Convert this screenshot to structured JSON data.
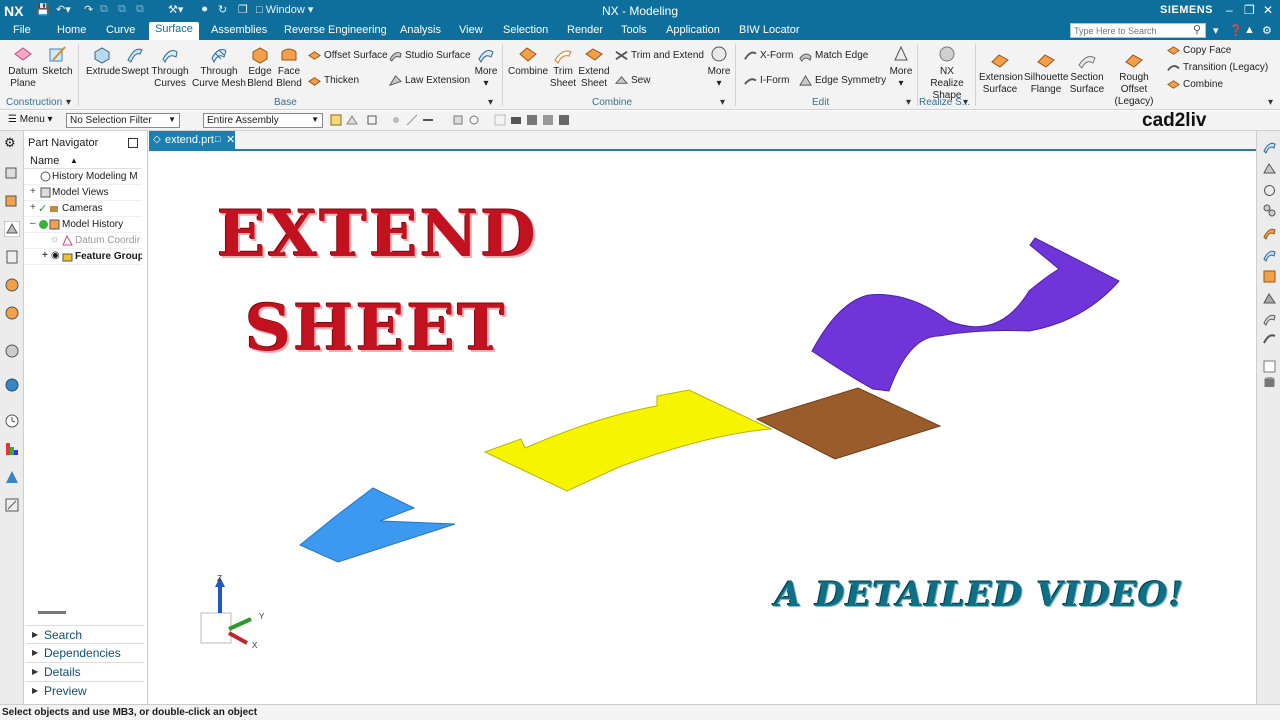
{
  "titlebar": {
    "logo": "NX",
    "window_label": "Window",
    "title": "NX - Modeling",
    "brand": "SIEMENS"
  },
  "tabs": [
    {
      "label": "File",
      "active": false
    },
    {
      "label": "Home",
      "active": false
    },
    {
      "label": "Curve",
      "active": false
    },
    {
      "label": "Surface",
      "active": true
    },
    {
      "label": "Assemblies",
      "active": false
    },
    {
      "label": "Reverse Engineering",
      "active": false
    },
    {
      "label": "Analysis",
      "active": false
    },
    {
      "label": "View",
      "active": false
    },
    {
      "label": "Selection",
      "active": false
    },
    {
      "label": "Render",
      "active": false
    },
    {
      "label": "Tools",
      "active": false
    },
    {
      "label": "Application",
      "active": false
    },
    {
      "label": "BIW Locator",
      "active": false
    }
  ],
  "search": {
    "placeholder": "Type Here to Search"
  },
  "ribbon": {
    "construction": {
      "datum_plane": "Datum Plane",
      "sketch": "Sketch",
      "group": "Construction"
    },
    "base": {
      "extrude": "Extrude",
      "swept": "Swept",
      "through_curves": "Through Curves",
      "through_curve_mesh": "Through Curve Mesh",
      "edge_blend": "Edge Blend",
      "face_blend": "Face Blend",
      "offset_surface": "Offset Surface",
      "thicken": "Thicken",
      "studio_surface": "Studio Surface",
      "law_extension": "Law Extension",
      "more": "More",
      "group": "Base"
    },
    "combine": {
      "combine": "Combine",
      "trim_sheet": "Trim Sheet",
      "extend_sheet": "Extend Sheet",
      "trim_and_extend": "Trim and Extend",
      "sew": "Sew",
      "more": "More",
      "group": "Combine"
    },
    "edit": {
      "x_form": "X-Form",
      "i_form": "I-Form",
      "match_edge": "Match Edge",
      "edge_symmetry": "Edge Symmetry",
      "more": "More",
      "group": "Edit"
    },
    "realize": {
      "nx_realize_shape": "NX Realize Shape",
      "group": "Realize S..."
    },
    "extra": {
      "extension_surface": "Extension Surface",
      "silhouette_flange": "Silhouette Flange",
      "section_surface": "Section Surface",
      "rough_offset": "Rough Offset (Legacy)",
      "copy_face": "Copy Face",
      "transition": "Transition (Legacy)",
      "combine": "Combine"
    }
  },
  "toolbar2": {
    "menu": "Menu",
    "selection_filter": "No Selection Filter",
    "scope": "Entire Assembly"
  },
  "brand_overlay": "cad2liv",
  "navigator": {
    "title": "Part Navigator",
    "column": "Name",
    "rows": [
      {
        "label": "History Modeling M"
      },
      {
        "label": "Model Views"
      },
      {
        "label": "Cameras"
      },
      {
        "label": "Model History"
      },
      {
        "label": "Datum Coordir"
      },
      {
        "label": "Feature Group"
      }
    ],
    "accordions": [
      "Search",
      "Dependencies",
      "Details",
      "Preview"
    ]
  },
  "doc_tab": {
    "label": "extend.prt"
  },
  "graphics": {
    "title_line1": "EXTEND",
    "title_line2": "SHEET",
    "subtitle": "A DETAILED VIDEO!",
    "axis_z": "Z",
    "axis_y": "Y",
    "axis_x": "X",
    "colors": {
      "blue_sheet": "#3b9af0",
      "yellow_sheet": "#f7f400",
      "brown_sheet": "#9a5c2a",
      "purple_sheet": "#7035d8",
      "title_red": "#c3121f",
      "subtitle_teal": "#0f6f86"
    }
  },
  "status": {
    "message": "Select objects and use MB3, or double-click an object"
  },
  "theme": {
    "accent": "#0e6f9c"
  }
}
